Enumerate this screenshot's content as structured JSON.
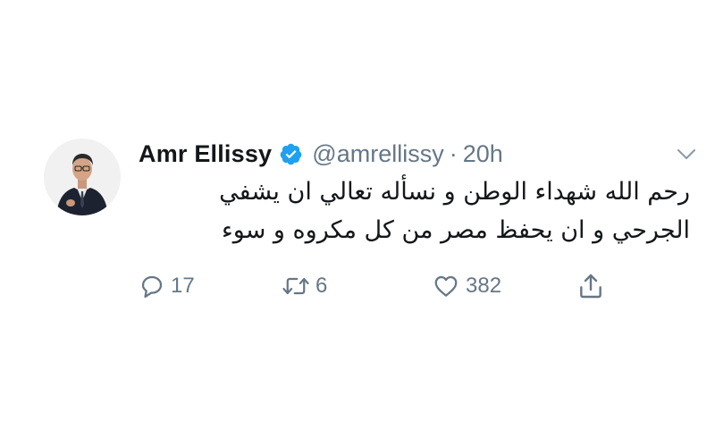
{
  "tweet": {
    "author": {
      "display_name": "Amr Ellissy",
      "handle": "@amrellissy",
      "verified": true
    },
    "separator": "·",
    "timestamp": "20h",
    "text_lines": [
      "رحم الله شهداء الوطن و نسأله تعالي ان يشفي",
      "الجرحي و ان يحفظ مصر من كل مكروه و سوء"
    ],
    "actions": {
      "replies": "17",
      "retweets": "6",
      "likes": "382"
    }
  },
  "icons": {
    "avatar": "avatar",
    "verified": "verified-badge-icon",
    "menu": "chevron-down-icon",
    "reply": "reply-icon",
    "retweet": "retweet-icon",
    "like": "heart-icon",
    "share": "share-icon"
  },
  "colors": {
    "text": "#14171a",
    "secondary": "#657786",
    "verified": "#1da1f2",
    "background": "#ffffff"
  }
}
